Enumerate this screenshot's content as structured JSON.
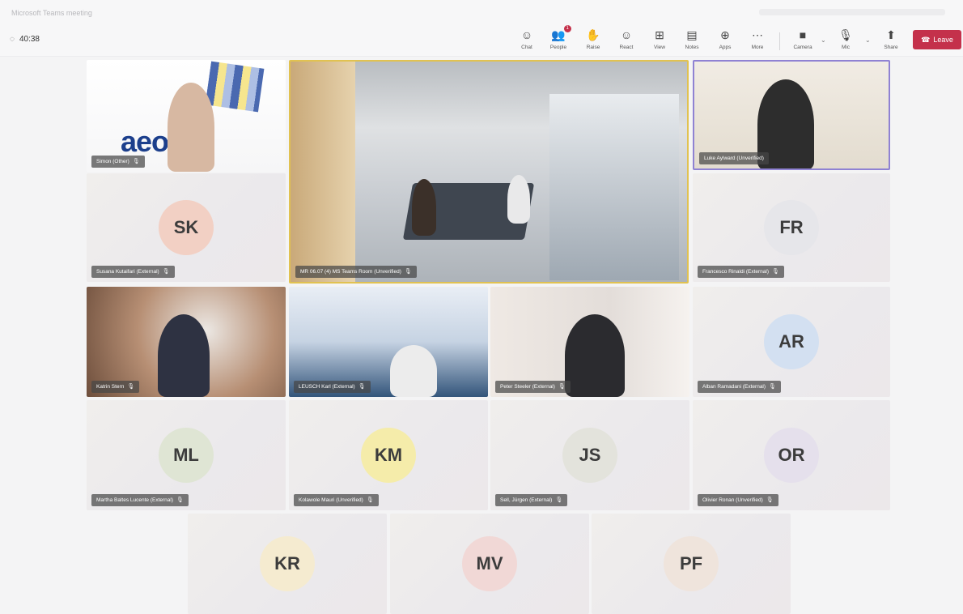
{
  "window": {
    "title": "Microsoft Teams meeting"
  },
  "toolbar": {
    "timer": "40:38",
    "buttons": [
      {
        "id": "chat",
        "label": "Chat",
        "icon": "chat-icon",
        "glyph": "☺"
      },
      {
        "id": "people",
        "label": "People",
        "icon": "people-icon",
        "glyph": "👥",
        "badge": "1"
      },
      {
        "id": "raise",
        "label": "Raise",
        "icon": "raise-hand-icon",
        "glyph": "✋"
      },
      {
        "id": "react",
        "label": "React",
        "icon": "react-icon",
        "glyph": "☺"
      },
      {
        "id": "view",
        "label": "View",
        "icon": "view-icon",
        "glyph": "⊞"
      },
      {
        "id": "notes",
        "label": "Notes",
        "icon": "notes-icon",
        "glyph": "▤"
      },
      {
        "id": "apps",
        "label": "Apps",
        "icon": "apps-icon",
        "glyph": "⊕"
      },
      {
        "id": "more",
        "label": "More",
        "icon": "more-icon",
        "glyph": "⋯"
      },
      {
        "id": "camera",
        "label": "Camera",
        "icon": "camera-icon",
        "glyph": "■"
      },
      {
        "id": "mic",
        "label": "Mic",
        "icon": "mic-off-icon",
        "glyph": "🎙"
      },
      {
        "id": "share",
        "label": "Share",
        "icon": "share-icon",
        "glyph": "⬆"
      }
    ],
    "leave_label": "Leave"
  },
  "tiles": {
    "simon": {
      "name": "Simon (Other)"
    },
    "room": {
      "name": "MR 06.07 (4) MS Teams Room (Unverified)"
    },
    "luke": {
      "name": "Luke Aylward (Unverified)"
    },
    "sk": {
      "initials": "SK",
      "name": "Susana Kutaifari (External)",
      "color": "#f2d0c4"
    },
    "fr": {
      "initials": "FR",
      "name": "Francesco Rinaldi (External)",
      "color": "#e6e6ea"
    },
    "katrin": {
      "name": "Katrin Stern"
    },
    "office": {
      "name": "LEUSCH Karl (External)"
    },
    "peter": {
      "name": "Peter Steeler (External)"
    },
    "ar": {
      "initials": "AR",
      "name": "Alban Ramadani (External)",
      "color": "#d3e0f1"
    },
    "ml": {
      "initials": "ML",
      "name": "Martha Baltes Lucente (External)",
      "color": "#dfe5d4"
    },
    "km": {
      "initials": "KM",
      "name": "Kolawole Mauri (Unverified)",
      "color": "#f5ecaa"
    },
    "js": {
      "initials": "JS",
      "name": "Sell, Jürgen (External)",
      "color": "#e3e3dc"
    },
    "or": {
      "initials": "OR",
      "name": "Olivier Ronan (Unverified)",
      "color": "#e5e0ec"
    },
    "kr": {
      "initials": "KR",
      "name": "",
      "color": "#f5ebd0"
    },
    "mv": {
      "initials": "MV",
      "name": "",
      "color": "#f1d8d6"
    },
    "pf": {
      "initials": "PF",
      "name": "",
      "color": "#efe4dc"
    }
  }
}
